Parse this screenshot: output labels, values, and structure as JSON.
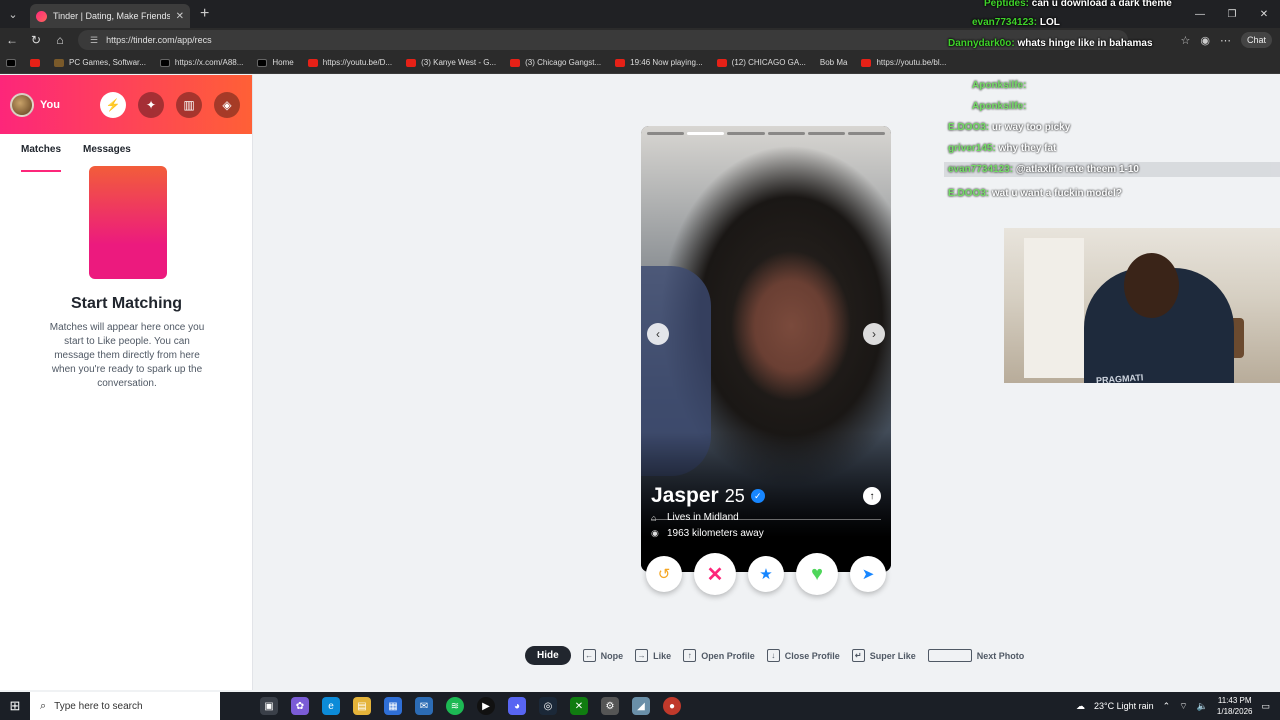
{
  "browser": {
    "tab_title": "Tinder | Dating, Make Friends & M...",
    "url": "https://tinder.com/app/recs",
    "chat_button": "Chat",
    "bookmarks": [
      {
        "label": "PC Games, Softwar...",
        "icon": "g"
      },
      {
        "label": "https://x.com/A88...",
        "icon": "x"
      },
      {
        "label": "Home",
        "icon": "x"
      },
      {
        "label": "https://youtu.be/D...",
        "icon": "yt"
      },
      {
        "label": "(3) Kanye West - G...",
        "icon": "yt"
      },
      {
        "label": "(3) Chicago Gangst...",
        "icon": "yt"
      },
      {
        "label": "19:46 Now playing...",
        "icon": "yt"
      },
      {
        "label": "(12) CHICAGO GA...",
        "icon": "yt"
      },
      {
        "label": "Bob Ma",
        "icon": "yt"
      },
      {
        "label": "https://youtu.be/bl...",
        "icon": "yt"
      }
    ]
  },
  "sidebar": {
    "you_label": "You",
    "tabs": [
      "Matches",
      "Messages"
    ],
    "start_title": "Start Matching",
    "start_desc": "Matches will appear here once you start to Like people. You can message them directly from here when you're ready to spark up the conversation."
  },
  "profile": {
    "name": "Jasper",
    "age": "25",
    "lives_in": "Lives in Midland",
    "distance": "1963 kilometers away",
    "photos_total": 6,
    "photo_active": 2
  },
  "hints": {
    "hide": "Hide",
    "nope": "Nope",
    "like": "Like",
    "open_profile": "Open Profile",
    "close_profile": "Close Profile",
    "super_like": "Super Like",
    "next_photo": "Next Photo"
  },
  "chat": [
    {
      "user": "Peptides:",
      "text": "can u download a dark theme"
    },
    {
      "user": "evan7734123:",
      "text": "LOL"
    },
    {
      "user": "Dannydark0o:",
      "text": "whats hinge like in bahamas"
    },
    {
      "user": "Aponksilfe:",
      "text": ""
    },
    {
      "user": "Aponksilfe:",
      "text": ""
    },
    {
      "user": "E.DOO3:",
      "text": "ur way too picky"
    },
    {
      "user": "griver145:",
      "text": "why they fat"
    },
    {
      "user": "evan7734123:",
      "text": "@atlaxlife rate theem 1-10"
    },
    {
      "user": "E.DOO3:",
      "text": "wat u want a fuckin model?"
    }
  ],
  "webcam": {
    "brand_text": "PRAGMATI"
  },
  "taskbar": {
    "search_placeholder": "Type here to search",
    "weather": "23°C  Light rain",
    "time": "11:43 PM",
    "date": "1/18/2026"
  },
  "colors": {
    "tinder_gradient_start": "#fd267a",
    "tinder_gradient_end": "#ff6036",
    "verified_blue": "#1786ff",
    "chat_username": "#3fd32a"
  }
}
